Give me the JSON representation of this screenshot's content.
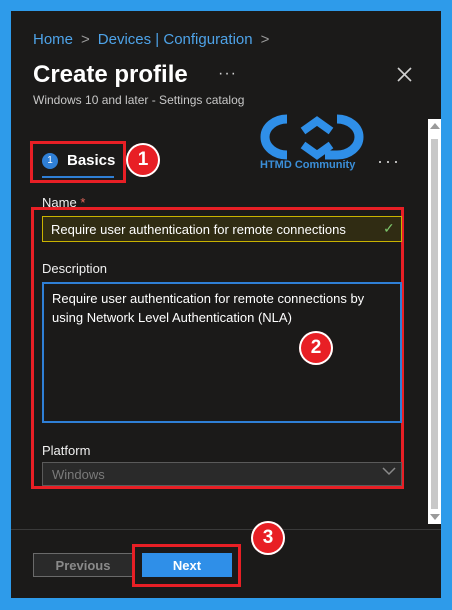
{
  "breadcrumb": {
    "items": [
      "Home",
      "Devices | Configuration"
    ],
    "separator": ">"
  },
  "header": {
    "title": "Create profile",
    "more_label": "···",
    "subtitle": "Windows 10 and later - Settings catalog"
  },
  "watermark": {
    "text": "HTMD Community"
  },
  "tab": {
    "step_number": "1",
    "label": "Basics",
    "more_label": "···"
  },
  "annotations": {
    "badge1": "1",
    "badge2": "2",
    "badge3": "3"
  },
  "form": {
    "name_label": "Name",
    "name_required_mark": "*",
    "name_value": "Require user authentication for remote connections",
    "description_label": "Description",
    "description_value": "Require user authentication for remote connections by using Network Level Authentication (NLA)",
    "platform_label": "Platform",
    "platform_value": "Windows"
  },
  "footer": {
    "previous_label": "Previous",
    "next_label": "Next"
  },
  "colors": {
    "frame": "#2e9bea",
    "background": "#1b1a19",
    "accent": "#2f8fe8",
    "highlight": "#e81f25",
    "name_input_border": "#c9b300"
  }
}
